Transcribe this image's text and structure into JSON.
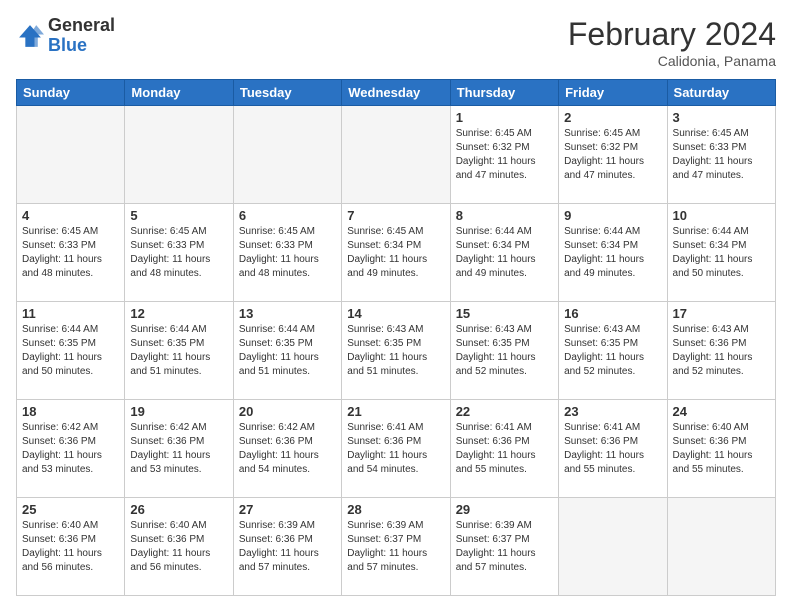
{
  "header": {
    "logo_general": "General",
    "logo_blue": "Blue",
    "title": "February 2024",
    "subtitle": "Calidonia, Panama"
  },
  "days_of_week": [
    "Sunday",
    "Monday",
    "Tuesday",
    "Wednesday",
    "Thursday",
    "Friday",
    "Saturday"
  ],
  "weeks": [
    [
      {
        "day": "",
        "empty": true
      },
      {
        "day": "",
        "empty": true
      },
      {
        "day": "",
        "empty": true
      },
      {
        "day": "",
        "empty": true
      },
      {
        "day": "1",
        "sunrise": "6:45 AM",
        "sunset": "6:32 PM",
        "daylight": "11 hours and 47 minutes."
      },
      {
        "day": "2",
        "sunrise": "6:45 AM",
        "sunset": "6:32 PM",
        "daylight": "11 hours and 47 minutes."
      },
      {
        "day": "3",
        "sunrise": "6:45 AM",
        "sunset": "6:33 PM",
        "daylight": "11 hours and 47 minutes."
      }
    ],
    [
      {
        "day": "4",
        "sunrise": "6:45 AM",
        "sunset": "6:33 PM",
        "daylight": "11 hours and 48 minutes."
      },
      {
        "day": "5",
        "sunrise": "6:45 AM",
        "sunset": "6:33 PM",
        "daylight": "11 hours and 48 minutes."
      },
      {
        "day": "6",
        "sunrise": "6:45 AM",
        "sunset": "6:33 PM",
        "daylight": "11 hours and 48 minutes."
      },
      {
        "day": "7",
        "sunrise": "6:45 AM",
        "sunset": "6:34 PM",
        "daylight": "11 hours and 49 minutes."
      },
      {
        "day": "8",
        "sunrise": "6:44 AM",
        "sunset": "6:34 PM",
        "daylight": "11 hours and 49 minutes."
      },
      {
        "day": "9",
        "sunrise": "6:44 AM",
        "sunset": "6:34 PM",
        "daylight": "11 hours and 49 minutes."
      },
      {
        "day": "10",
        "sunrise": "6:44 AM",
        "sunset": "6:34 PM",
        "daylight": "11 hours and 50 minutes."
      }
    ],
    [
      {
        "day": "11",
        "sunrise": "6:44 AM",
        "sunset": "6:35 PM",
        "daylight": "11 hours and 50 minutes."
      },
      {
        "day": "12",
        "sunrise": "6:44 AM",
        "sunset": "6:35 PM",
        "daylight": "11 hours and 51 minutes."
      },
      {
        "day": "13",
        "sunrise": "6:44 AM",
        "sunset": "6:35 PM",
        "daylight": "11 hours and 51 minutes."
      },
      {
        "day": "14",
        "sunrise": "6:43 AM",
        "sunset": "6:35 PM",
        "daylight": "11 hours and 51 minutes."
      },
      {
        "day": "15",
        "sunrise": "6:43 AM",
        "sunset": "6:35 PM",
        "daylight": "11 hours and 52 minutes."
      },
      {
        "day": "16",
        "sunrise": "6:43 AM",
        "sunset": "6:35 PM",
        "daylight": "11 hours and 52 minutes."
      },
      {
        "day": "17",
        "sunrise": "6:43 AM",
        "sunset": "6:36 PM",
        "daylight": "11 hours and 52 minutes."
      }
    ],
    [
      {
        "day": "18",
        "sunrise": "6:42 AM",
        "sunset": "6:36 PM",
        "daylight": "11 hours and 53 minutes."
      },
      {
        "day": "19",
        "sunrise": "6:42 AM",
        "sunset": "6:36 PM",
        "daylight": "11 hours and 53 minutes."
      },
      {
        "day": "20",
        "sunrise": "6:42 AM",
        "sunset": "6:36 PM",
        "daylight": "11 hours and 54 minutes."
      },
      {
        "day": "21",
        "sunrise": "6:41 AM",
        "sunset": "6:36 PM",
        "daylight": "11 hours and 54 minutes."
      },
      {
        "day": "22",
        "sunrise": "6:41 AM",
        "sunset": "6:36 PM",
        "daylight": "11 hours and 55 minutes."
      },
      {
        "day": "23",
        "sunrise": "6:41 AM",
        "sunset": "6:36 PM",
        "daylight": "11 hours and 55 minutes."
      },
      {
        "day": "24",
        "sunrise": "6:40 AM",
        "sunset": "6:36 PM",
        "daylight": "11 hours and 55 minutes."
      }
    ],
    [
      {
        "day": "25",
        "sunrise": "6:40 AM",
        "sunset": "6:36 PM",
        "daylight": "11 hours and 56 minutes."
      },
      {
        "day": "26",
        "sunrise": "6:40 AM",
        "sunset": "6:36 PM",
        "daylight": "11 hours and 56 minutes."
      },
      {
        "day": "27",
        "sunrise": "6:39 AM",
        "sunset": "6:36 PM",
        "daylight": "11 hours and 57 minutes."
      },
      {
        "day": "28",
        "sunrise": "6:39 AM",
        "sunset": "6:37 PM",
        "daylight": "11 hours and 57 minutes."
      },
      {
        "day": "29",
        "sunrise": "6:39 AM",
        "sunset": "6:37 PM",
        "daylight": "11 hours and 57 minutes."
      },
      {
        "day": "",
        "empty": true
      },
      {
        "day": "",
        "empty": true
      }
    ]
  ]
}
